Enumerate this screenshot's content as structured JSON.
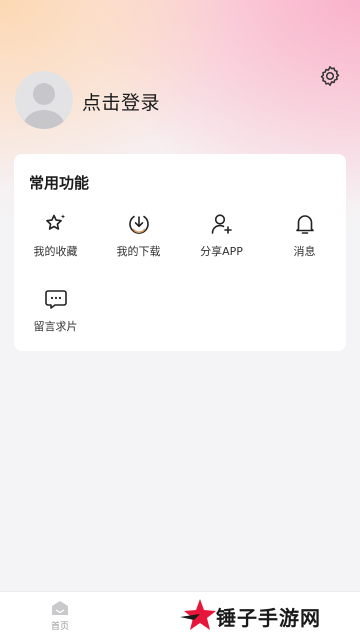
{
  "profile": {
    "login_prompt": "点击登录"
  },
  "functions_card": {
    "title": "常用功能",
    "items": [
      {
        "label": "我的收藏",
        "icon": "star-sparkle-icon"
      },
      {
        "label": "我的下载",
        "icon": "download-circle-icon"
      },
      {
        "label": "分享APP",
        "icon": "user-add-icon"
      },
      {
        "label": "消息",
        "icon": "bell-icon"
      },
      {
        "label": "留言求片",
        "icon": "chat-bubble-icon"
      }
    ]
  },
  "bottom_nav": {
    "home_label": "首页"
  },
  "watermark": {
    "text": "锤子手游网"
  },
  "colors": {
    "accent_gradient_left": "#fcd9b4",
    "accent_gradient_right": "#f9b2cb",
    "background": "#f4f4f6",
    "watermark_red": "#e8163a"
  }
}
